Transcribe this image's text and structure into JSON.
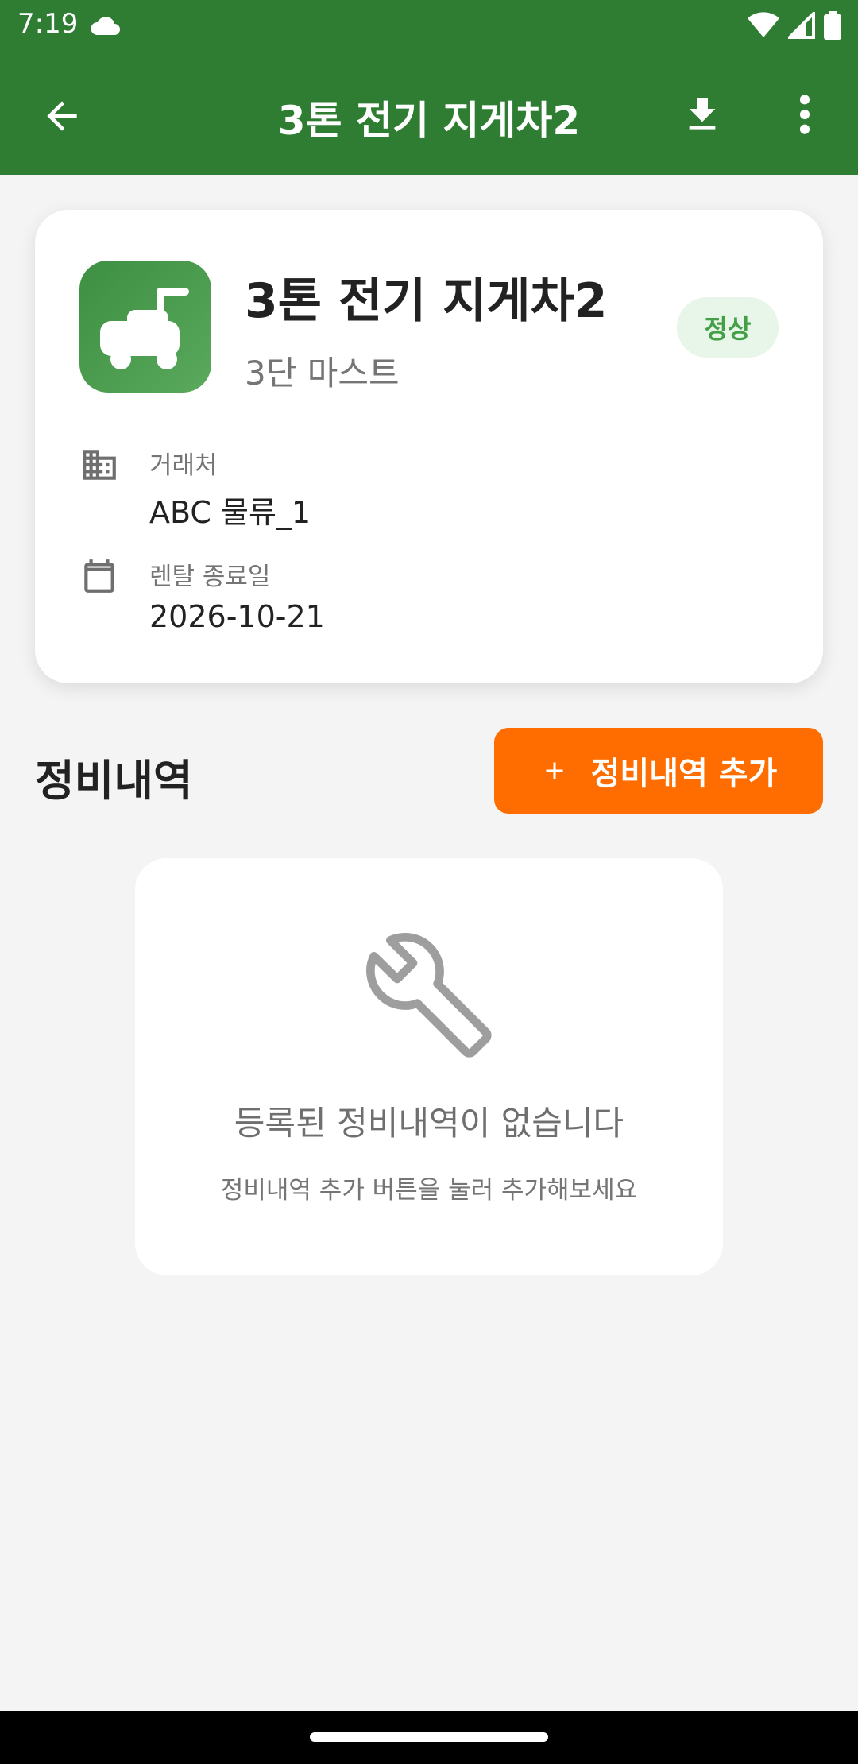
{
  "status_bar": {
    "time": "7:19"
  },
  "app_bar": {
    "title": "3톤 전기 지게차2"
  },
  "equipment": {
    "name": "3톤 전기 지게차2",
    "subtitle": "3단 마스트",
    "status_badge": "정상",
    "fields": [
      {
        "label": "거래처",
        "value": "ABC 물류_1",
        "icon": "building-icon"
      },
      {
        "label": "렌탈 종료일",
        "value": "2026-10-21",
        "icon": "calendar-icon"
      }
    ]
  },
  "maintenance": {
    "section_title": "정비내역",
    "add_button_label": "정비내역 추가",
    "empty_title": "등록된 정비내역이 없습니다",
    "empty_subtitle": "정비내역 추가 버튼을 눌러 추가해보세요"
  },
  "colors": {
    "primary": "#2e7d32",
    "accent": "#ff6d00",
    "badge_bg": "#e8f5e9",
    "badge_text": "#43a047"
  }
}
